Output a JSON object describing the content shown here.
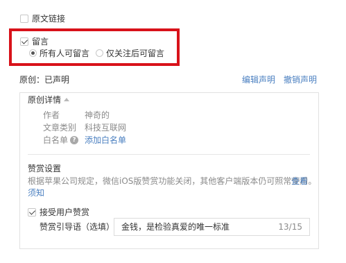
{
  "original_link": {
    "label": "原文链接",
    "checked": false
  },
  "comment": {
    "label": "留言",
    "checked": true,
    "options": [
      {
        "label": "所有人可留言",
        "selected": true
      },
      {
        "label": "仅关注后可留言",
        "selected": false
      }
    ]
  },
  "original": {
    "status_label": "原创：已声明",
    "edit_link": "编辑声明",
    "revoke_link": "撤销声明"
  },
  "details": {
    "title": "原创详情",
    "rows": [
      {
        "key": "作者",
        "value": "神奇的"
      },
      {
        "key": "文章类别",
        "value": "科技互联网"
      },
      {
        "key": "白名单",
        "value": "添加白名单"
      }
    ]
  },
  "appreciation": {
    "title": "赞赏设置",
    "notice_line1": "根据苹果公司规定，微信iOS版赞赏功能关闭，其他客户端版本仍可照常使用。",
    "notice_link_part1": "查看",
    "notice_link_part2": "须知",
    "accept_label": "接受用户赞赏",
    "accept_checked": true,
    "guide_label": "赞赏引导语（选填）",
    "guide_value": "金钱，是检验真爱的唯一标准",
    "guide_count": "13/15"
  },
  "colors": {
    "accent_link": "#4a7fc0",
    "highlight_box": "#d8121a"
  }
}
